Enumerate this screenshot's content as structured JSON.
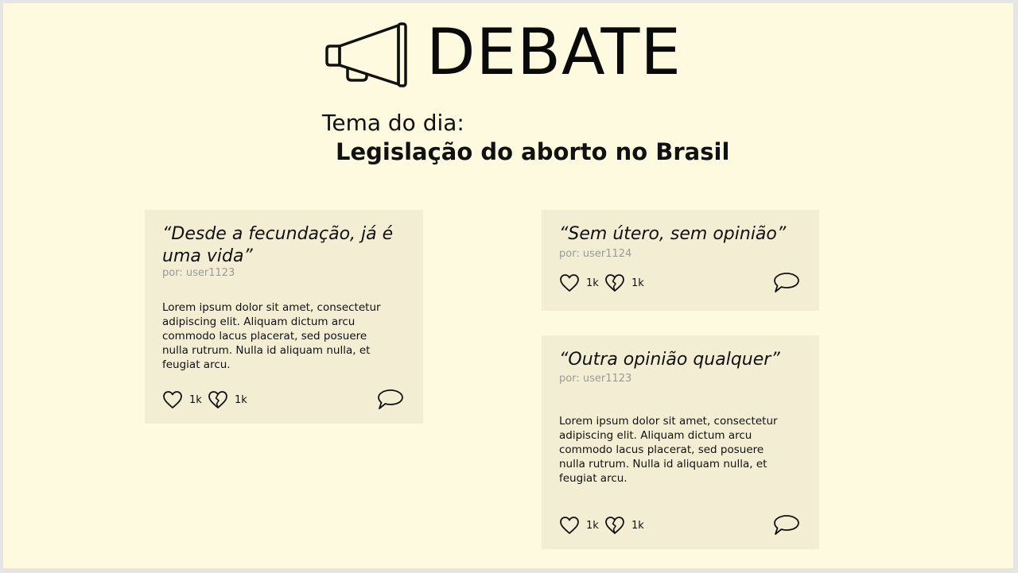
{
  "header": {
    "brand": "DEBATE",
    "brand_icon": "megaphone-icon",
    "theme_prefix": "Tema do dia:",
    "theme_title": "Legislação do aborto no Brasil"
  },
  "cards": [
    {
      "quote": "“Desde a fecundação, já é uma vida”",
      "author": "por: user1123",
      "body": "Lorem ipsum dolor sit amet, consectetur adipiscing elit. Aliquam dictum arcu commodo lacus placerat, sed posuere nulla rutrum. Nulla id aliquam nulla, et feugiat arcu.",
      "likes": "1k",
      "dislikes": "1k"
    },
    {
      "quote": "“Sem útero, sem opinião”",
      "author": "por: user1124",
      "likes": "1k",
      "dislikes": "1k"
    },
    {
      "quote": "“Outra opinião qualquer”",
      "author": "por: user1123",
      "body": "Lorem ipsum dolor sit amet, consectetur adipiscing elit. Aliquam dictum arcu commodo lacus placerat, sed posuere nulla rutrum. Nulla id aliquam nulla, et feugiat arcu.",
      "likes": "1k",
      "dislikes": "1k"
    }
  ],
  "colors": {
    "page_background": "#fefadf",
    "card_background": "#f3edd4",
    "author_text": "#9a9a96"
  },
  "icons": [
    "megaphone-icon",
    "heart-icon",
    "broken-heart-icon",
    "comment-icon"
  ]
}
